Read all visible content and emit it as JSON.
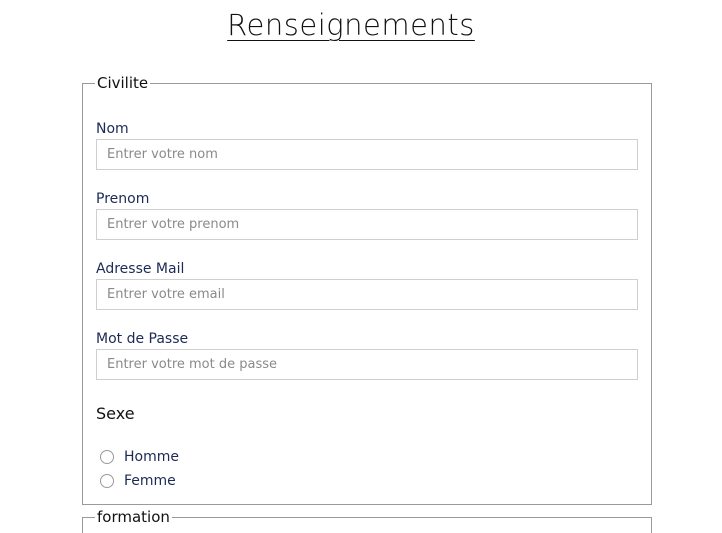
{
  "page": {
    "title": "Renseignements"
  },
  "civilite": {
    "legend": "Civilite",
    "fields": [
      {
        "label": "Nom",
        "value": "",
        "placeholder": "Entrer votre nom"
      },
      {
        "label": "Prenom",
        "value": "",
        "placeholder": "Entrer votre prenom"
      },
      {
        "label": "Adresse Mail",
        "value": "",
        "placeholder": "Entrer votre email"
      },
      {
        "label": "Mot de Passe",
        "value": "",
        "placeholder": "Entrer votre mot de passe"
      }
    ],
    "sexe": {
      "label": "Sexe",
      "options": [
        {
          "label": "Homme",
          "checked": false
        },
        {
          "label": "Femme",
          "checked": false
        }
      ]
    }
  },
  "formation": {
    "legend": "formation"
  },
  "colors": {
    "label_text": "#1c2a56",
    "border": "#9a9a9a",
    "input_border": "#cfcfcf",
    "placeholder": "#8a8a8a"
  }
}
